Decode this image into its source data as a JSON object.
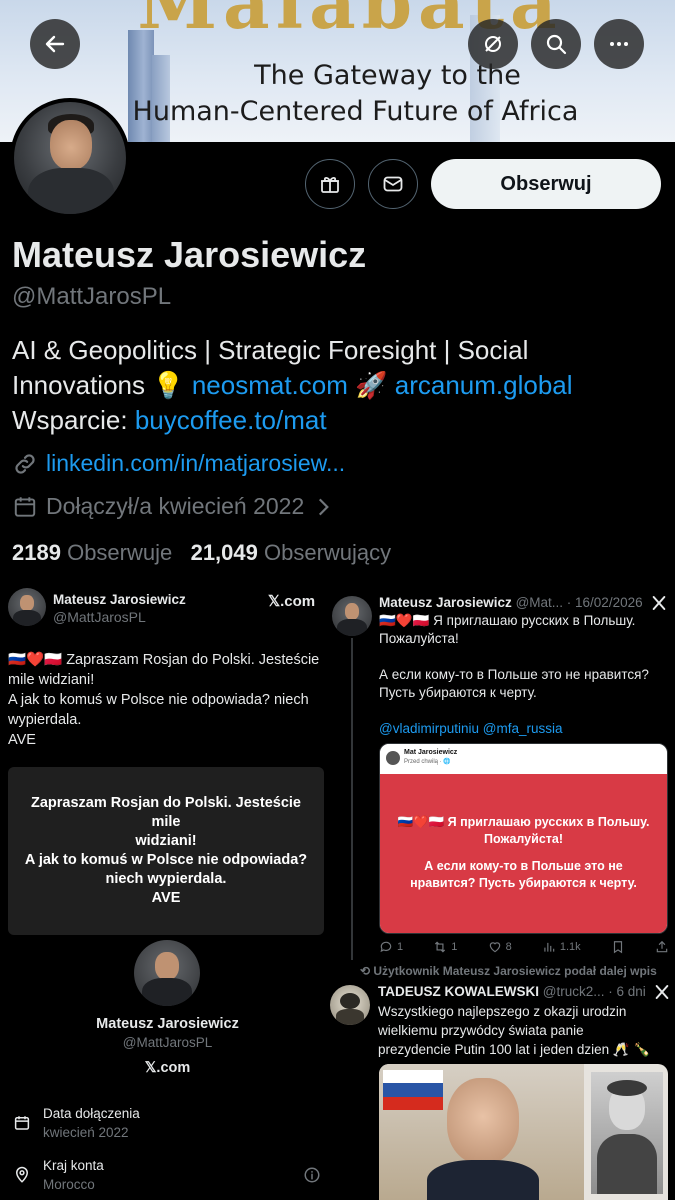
{
  "banner": {
    "word": "Malabata",
    "tagline_line1": "The Gateway to the",
    "tagline_line2": "Human-Centered Future of Africa"
  },
  "top_icons": [
    "back-arrow-icon",
    "no-location-icon",
    "search-icon",
    "more-icon"
  ],
  "profile": {
    "follow_label": "Obserwuj",
    "name": "Mateusz Jarosiewicz",
    "handle": "@MattJarosPL",
    "bio_line1": "AI & Geopolitics | Strategic Foresight | Social",
    "bio_line2_text": "Innovations 💡",
    "bio_link1": "neosmat.com",
    "bio_rocket": "🚀",
    "bio_link2": "arcanum.global",
    "bio_line3_text": "Wsparcie:",
    "bio_link3": "buycoffee.to/mat",
    "website": "linkedin.com/in/matjarosiew...",
    "joined": "Dołączył/a kwiecień 2022",
    "following_count": "2189",
    "following_label": "Obserwuje",
    "followers_count": "21,049",
    "followers_label": "Obserwujący"
  },
  "left_card": {
    "name": "Mateusz Jarosiewicz",
    "handle": "@MattJarosPL",
    "source": "𝕏.com",
    "text_line1": "🇷🇺❤️🇵🇱 Zapraszam Rosjan do Polski. Jesteście",
    "text_line2": "mile widziani!",
    "text_line3": "A jak to komuś w Polsce nie odpowiada? niech",
    "text_line4": "wypierdala.",
    "text_line5": "AVE",
    "quote_line1": "Zapraszam Rosjan do Polski. Jesteście mile",
    "quote_line2": "widziani!",
    "quote_line3": "A jak to komuś w Polsce nie odpowiada?",
    "quote_line4": "niech wypierdala.",
    "quote_line5": "AVE",
    "profile_name": "Mateusz Jarosiewicz",
    "profile_handle": "@MattJarosPL",
    "profile_source": "𝕏.com",
    "joined_label": "Data dołączenia",
    "joined_value": "kwiecień 2022",
    "country_label": "Kraj konta",
    "country_value": "Morocco"
  },
  "right_tweet": {
    "name": "Mateusz Jarosiewicz",
    "handle_date": "@Mat... · 16/02/2026",
    "line1": "🇷🇺❤️🇵🇱 Я приглашаю русских в Польшу.",
    "line2": "Пожалуйста!",
    "line3": "А если кому-то в Польше это не нравится?",
    "line4": "Пусть убираются к черту.",
    "mentions": "@vladimirputiniu @mfa_russia",
    "card_author": "Mat Jarosiewicz",
    "card_time": "Przed chwilą · 🌐",
    "card_line1": "🇷🇺❤️🇵🇱 Я приглашаю русских в Польшу.",
    "card_line2": "Пожалуйста!",
    "card_line3": "А если кому-то в Польше это не",
    "card_line4": "нравится? Пусть убираются к черту.",
    "replies": "1",
    "reposts": "1",
    "likes": "8",
    "views": "1.1k"
  },
  "retweet": {
    "label": "Użytkownik Mateusz Jarosiewicz podał dalej wpis",
    "name": "TADEUSZ KOWALEWSKI",
    "handle_date": "@truck2... · 6 dni",
    "line1": "Wszystkiego najlepszego z okazji urodzin",
    "line2": "wielkiemu przywódcy świata panie",
    "line3": "prezydencie Putin 100 lat i jeden dzien 🥂 🍾"
  }
}
